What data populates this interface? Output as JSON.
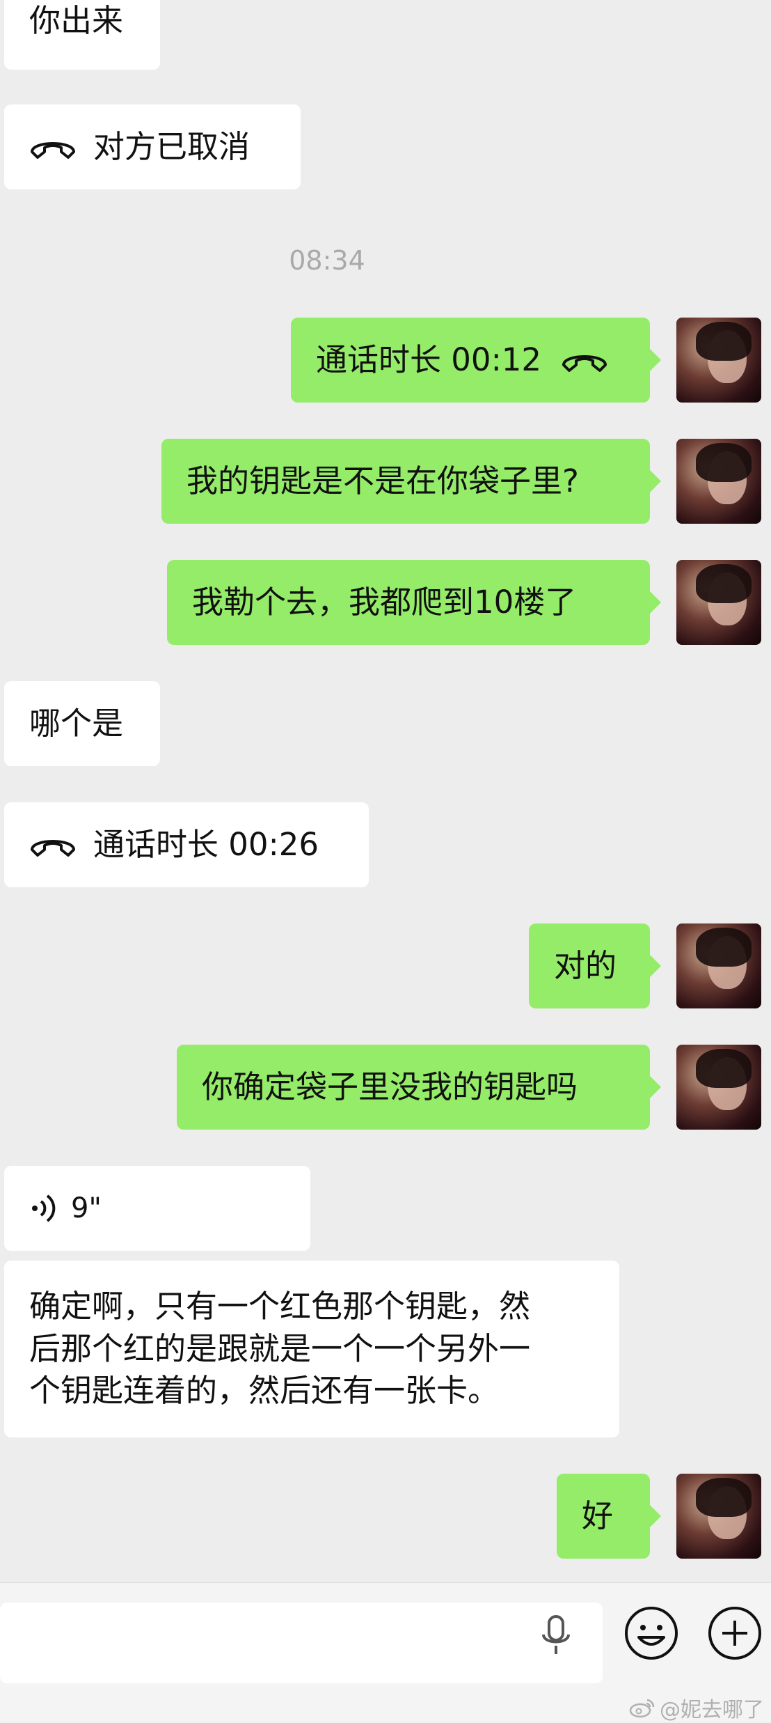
{
  "conversation": {
    "messages": [
      {
        "from": "other",
        "text": "你出来"
      },
      {
        "from": "other",
        "type": "call",
        "text": "对方已取消"
      },
      {
        "type": "time",
        "text": "08:34"
      },
      {
        "from": "me",
        "type": "call",
        "text": "通话时长 00:12"
      },
      {
        "from": "me",
        "text": "我的钥匙是不是在你袋子里?"
      },
      {
        "from": "me",
        "text": "我勒个去，我都爬到10楼了"
      },
      {
        "from": "other",
        "text": "哪个是"
      },
      {
        "from": "other",
        "type": "call",
        "text": "通话时长 00:26"
      },
      {
        "from": "me",
        "text": "对的"
      },
      {
        "from": "me",
        "text": "你确定袋子里没我的钥匙吗"
      },
      {
        "from": "other",
        "type": "voice",
        "text": "9\""
      },
      {
        "from": "other",
        "type": "transcript",
        "lines": [
          "确定啊，只有一个红色那个钥匙，然",
          "后那个红的是跟就是一个一个另外一",
          "个钥匙连着的，然后还有一张卡。"
        ]
      },
      {
        "from": "me",
        "text": "好"
      }
    ]
  },
  "watermark": {
    "text": "@妮去哪了"
  },
  "icons": {
    "call": "phone-handset-icon",
    "voice": "voice-wave-icon",
    "input_voice": "microphone-icon",
    "emoji": "emoji-icon",
    "add": "plus-circle-icon"
  },
  "colors": {
    "background": "#ededed",
    "outgoing_bubble": "#95ec69",
    "incoming_bubble": "#ffffff",
    "timestamp": "#a9a9a9"
  }
}
